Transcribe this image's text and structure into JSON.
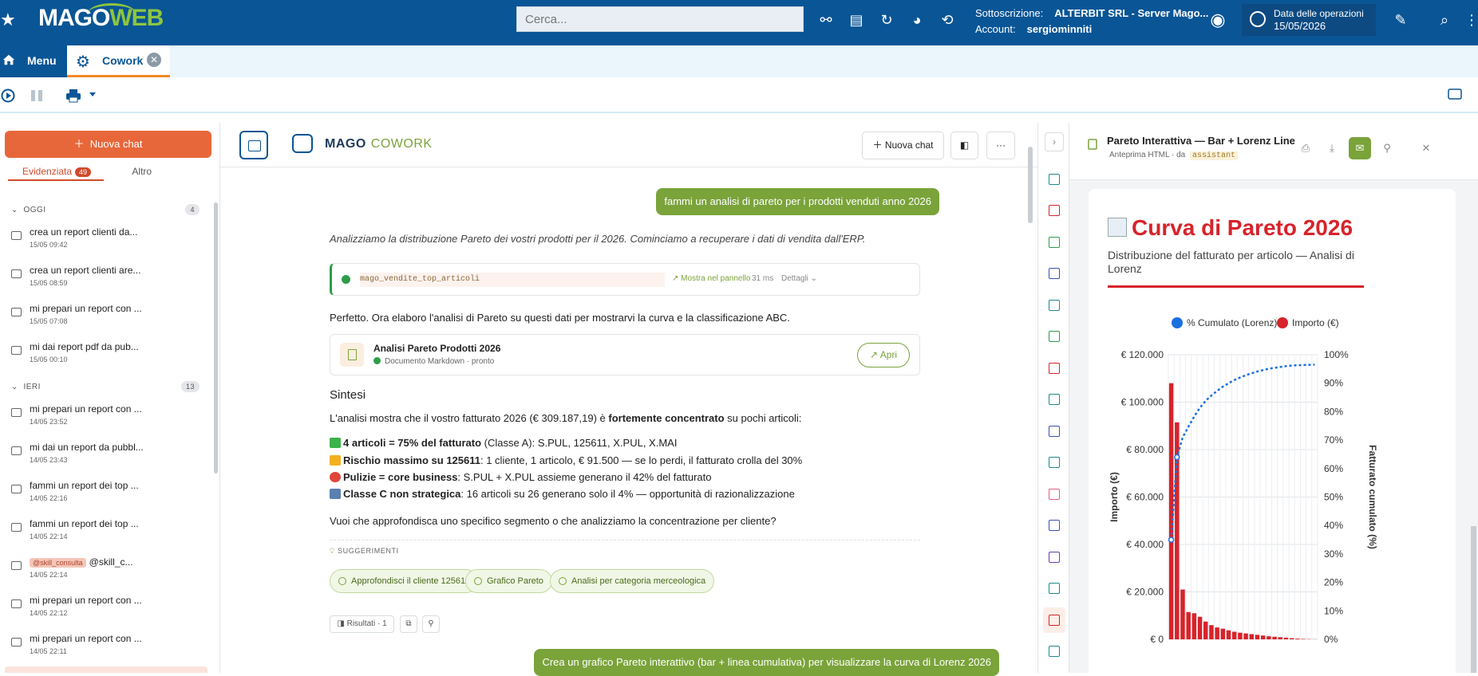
{
  "app": {
    "logo_a": "MAGO",
    "logo_b": "WEB",
    "search_placeholder": "Cerca...",
    "subscription_label": "Sottoscrizione:",
    "subscription_value": "ALTERBIT SRL - Server Mago...",
    "account_label": "Account:",
    "account_value": "sergiominniti",
    "date_label": "Data delle operazioni",
    "date_value": "15/05/2026",
    "colors": {
      "brand": "#0a5596",
      "accent": "#7aa33a",
      "orange": "#e8673a",
      "red": "#d7232a"
    }
  },
  "tabs": {
    "menu": "Menu",
    "cowork": "Cowork"
  },
  "sidebar": {
    "new_chat": "Nuova chat",
    "tab_highlight": "Evidenziata",
    "tab_highlight_count": "49",
    "tab_other": "Altro",
    "section_today": "OGGI",
    "section_today_count": "4",
    "section_yesterday": "IERI",
    "section_yesterday_count": "13",
    "chats": [
      {
        "title": "crea un report clienti da...",
        "date": "15/05 09:42"
      },
      {
        "title": "crea un report clienti are...",
        "date": "15/05 08:59"
      },
      {
        "title": "mi prepari un report con ...",
        "date": "15/05 07:08"
      },
      {
        "title": "mi dai report pdf da pub...",
        "date": "15/05 00:10"
      },
      {
        "title": "mi prepari un report con ...",
        "date": "14/05 23:52"
      },
      {
        "title": "mi dai un report da pubbl...",
        "date": "14/05 23:43"
      },
      {
        "title": "fammi un report dei top ...",
        "date": "14/05 22:16"
      },
      {
        "title": "fammi un report dei top ...",
        "date": "14/05 22:14"
      },
      {
        "skill": "@skill_consulta",
        "title": "@skill_c...",
        "date": "14/05 22:14"
      },
      {
        "title": "mi prepari un report con ...",
        "date": "14/05 22:12"
      },
      {
        "title": "mi prepari un report con ...",
        "date": "14/05 22:11"
      }
    ]
  },
  "main": {
    "title_a": "MAGO",
    "title_b": "COWORK",
    "new_chat": "Nuova chat",
    "user_msg_1": "fammi un analisi di pareto per i prodotti venduti anno 2026",
    "intro": "Analizziamo la distribuzione Pareto dei vostri prodotti per il 2026. Cominciamo a recuperare i dati di vendita dall'ERP.",
    "tool_name": "mago_vendite_top_articoli",
    "tool_show": "Mostra nel pannello",
    "tool_time": "31 ms",
    "tool_details": "Dettagli",
    "perfetto": "Perfetto. Ora elaboro l'analisi di Pareto su questi dati per mostrarvi la curva e la classificazione ABC.",
    "doc_title": "Analisi Pareto Prodotti 2026",
    "doc_sub": "Documento Markdown · pronto",
    "doc_open": "Apri",
    "sintesi": "Sintesi",
    "summary_a": "L'analisi mostra che il vostro fatturato 2026 (€ 309.187,19) è ",
    "summary_b": "fortemente concentrato",
    "summary_c": " su pochi articoli:",
    "bullets": [
      {
        "bold": "4 articoli = 75% del fatturato",
        "rest": " (Classe A): S.PUL, 125611, X.PUL, X.MAI",
        "color": "#3bb34a"
      },
      {
        "bold": "Rischio massimo su 125611",
        "rest": ": 1 cliente, 1 articolo, € 91.500 — se lo perdi, il fatturato crolla del 30%",
        "color": "#f2b01e"
      },
      {
        "bold": "Pulizie = core business",
        "rest": ": S.PUL + X.PUL assieme generano il 42% del fatturato",
        "color": "#e0453a"
      },
      {
        "bold": "Classe C non strategica",
        "rest": ": 16 articoli su 26 generano solo il 4% — opportunità di razionalizzazione",
        "color": "#5a7fb0"
      }
    ],
    "question": "Vuoi che approfondisca uno specifico segmento o che analizziamo la concentrazione per cliente?",
    "suggestions_label": "SUGGERIMENTI",
    "suggestions": [
      "Approfondisci il cliente 125611",
      "Grafico Pareto",
      "Analisi per categoria merceologica"
    ],
    "results": "Risultati · 1",
    "user_msg_2": "Crea un grafico Pareto interattivo (bar + linea cumulativa) per visualizzare la curva di Lorenz 2026"
  },
  "panel": {
    "title": "Pareto Interattiva — Bar + Lorenz Line",
    "sub": "Anteprima HTML · da",
    "sub_tag": "assistant",
    "chart_title": "Curva di Pareto 2026",
    "chart_subtitle": "Distribuzione del fatturato per articolo — Analisi di Lorenz"
  },
  "chart_data": {
    "type": "bar",
    "legend": [
      "% Cumulato (Lorenz)",
      "Importo (€)"
    ],
    "legend_position": "top",
    "ylabel": "Importo (€)",
    "y2label": "Fatturato cumulato (%)",
    "ylim": [
      0,
      120000
    ],
    "y2lim": [
      0,
      100
    ],
    "yticks": [
      "€ 0",
      "€ 20.000",
      "€ 40.000",
      "€ 60.000",
      "€ 80.000",
      "€ 100.000",
      "€ 120.000"
    ],
    "y2ticks": [
      "0%",
      "10%",
      "20%",
      "30%",
      "40%",
      "50%",
      "60%",
      "70%",
      "80%",
      "90%",
      "100%"
    ],
    "grid": true,
    "series": [
      {
        "name": "Importo (€)",
        "color": "#d7232a",
        "values": [
          108000,
          91500,
          21000,
          11500,
          11000,
          9500,
          7500,
          6000,
          5000,
          4500,
          3800,
          3200,
          2800,
          2500,
          2200,
          1900,
          1600,
          1300,
          1100,
          900,
          700,
          500,
          300,
          200,
          100,
          50
        ]
      },
      {
        "name": "% Cumulato (Lorenz)",
        "color": "#1a6fe0",
        "values": [
          35,
          64,
          71,
          74.7,
          78.3,
          81.4,
          83.8,
          85.7,
          87.3,
          88.8,
          90,
          91.1,
          92,
          92.8,
          93.5,
          94.1,
          94.6,
          95.1,
          95.4,
          95.7,
          96,
          96.2,
          96.3,
          96.4,
          96.45,
          96.5
        ]
      }
    ]
  }
}
